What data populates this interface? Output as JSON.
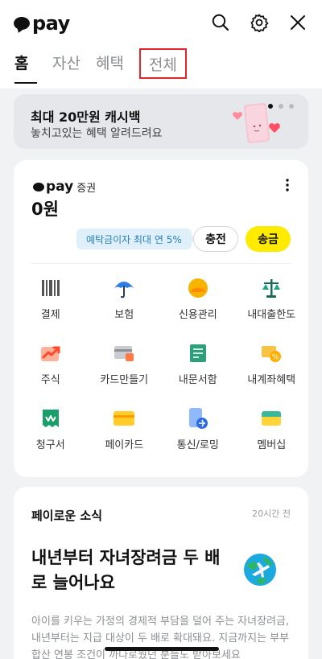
{
  "header": {
    "logo_text": "pay",
    "icons": [
      "search-icon",
      "gear-icon",
      "close-icon"
    ]
  },
  "tabs": [
    {
      "label": "홈",
      "active": true
    },
    {
      "label": "자산",
      "active": false
    },
    {
      "label": "혜택",
      "active": false
    },
    {
      "label": "전체",
      "active": false,
      "highlighted": true
    }
  ],
  "banner": {
    "title": "최대 20만원 캐시백",
    "subtitle": "놓치고있는 혜택 알려드려요",
    "page_dots": 3,
    "current_dot": 1
  },
  "account": {
    "brand": "pay",
    "label": "증권",
    "balance": "0원",
    "interest_tip": "예탁금이자 최대 연 5%",
    "charge_label": "충전",
    "send_label": "송금"
  },
  "services": [
    {
      "label": "결제",
      "icon": "barcode-icon"
    },
    {
      "label": "보험",
      "icon": "umbrella-icon"
    },
    {
      "label": "신용관리",
      "icon": "credit-gauge-icon"
    },
    {
      "label": "내대출한도",
      "icon": "scale-icon"
    },
    {
      "label": "주식",
      "icon": "stock-chart-icon"
    },
    {
      "label": "카드만들기",
      "icon": "card-make-icon"
    },
    {
      "label": "내문서함",
      "icon": "document-icon"
    },
    {
      "label": "내계좌혜택",
      "icon": "account-benefit-icon"
    },
    {
      "label": "청구서",
      "icon": "bill-icon"
    },
    {
      "label": "페이카드",
      "icon": "pay-card-icon"
    },
    {
      "label": "통신/로밍",
      "icon": "roaming-icon"
    },
    {
      "label": "멤버십",
      "icon": "membership-icon"
    }
  ],
  "news": {
    "section_title": "페이로운 소식",
    "time": "20시간 전",
    "headline": "내년부터 자녀장려금 두 배로 늘어나요",
    "body": "아이를 키우는 가정의 경제적 부담을 덜어 주는 자녀장려금, 내년부터는 지급 대상이 두 배로 확대돼요. 지금까지는 부부 합산 연봉 조건이 까다로웠던 분들도 받아보세요"
  },
  "colors": {
    "brand_yellow": "#ffeb00",
    "highlight_red": "#e4242b",
    "tip_blue": "#2a7fb8"
  }
}
